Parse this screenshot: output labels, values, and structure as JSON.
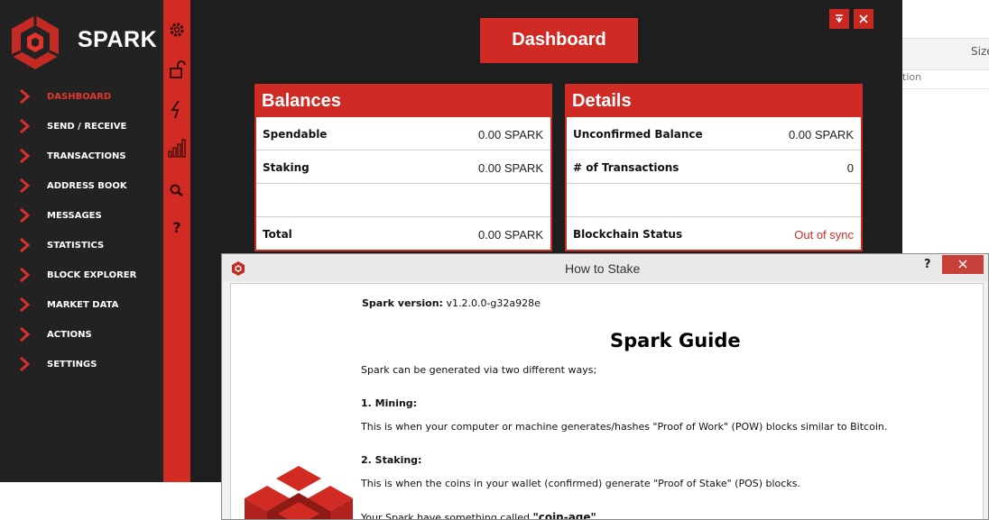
{
  "app": {
    "brand": "SPARK",
    "nav": [
      {
        "label": "DASHBOARD",
        "active": true
      },
      {
        "label": "SEND / RECEIVE"
      },
      {
        "label": "TRANSACTIONS"
      },
      {
        "label": "ADDRESS BOOK"
      },
      {
        "label": "MESSAGES"
      },
      {
        "label": "STATISTICS"
      },
      {
        "label": "BLOCK EXPLORER"
      },
      {
        "label": "MARKET DATA"
      },
      {
        "label": "ACTIONS"
      },
      {
        "label": "SETTINGS"
      }
    ],
    "toolbar_icons": [
      "gear-icon",
      "unlock-icon",
      "lightning-icon",
      "signal-icon",
      "search-icon",
      "help-icon"
    ],
    "dashboard_button": "Dashboard",
    "balances": {
      "title": "Balances",
      "rows": [
        {
          "key": "Spendable",
          "value": "0.00 SPARK"
        },
        {
          "key": "Staking",
          "value": "0.00 SPARK"
        },
        {
          "key": "",
          "value": ""
        },
        {
          "key": "Total",
          "value": "0.00 SPARK"
        }
      ]
    },
    "details": {
      "title": "Details",
      "rows": [
        {
          "key": "Unconfirmed Balance",
          "value": "0.00 SPARK"
        },
        {
          "key": "# of Transactions",
          "value": "0"
        },
        {
          "key": "",
          "value": ""
        },
        {
          "key": "Blockchain Status",
          "value": "Out of sync"
        }
      ]
    },
    "colors": {
      "accent": "#cf2b24",
      "sidebar": "#222222",
      "main": "#1e1e1e"
    }
  },
  "dialog": {
    "title": "How to Stake",
    "help": "?",
    "version_label": "Spark version:",
    "version_value": " v1.2.0.0-g32a928e",
    "guide_title": "Spark Guide",
    "intro": "Spark can be generated via two different ways;",
    "mining_heading": "1. Mining:",
    "mining_text": "This is when your computer or machine generates/hashes \"Proof of Work\" (POW) blocks similar to Bitcoin.",
    "staking_heading": "2. Staking:",
    "staking_text": "This is when the coins in your wallet (confirmed) generate \"Proof of Stake\" (POS) blocks.",
    "coinage_text_pre": "Your Spark have something called ",
    "coinage_text_bold": "\"coin-age\"",
    "coinage_text_post": "."
  },
  "background_window": {
    "column_header": "Size",
    "partial_text": "tion"
  }
}
